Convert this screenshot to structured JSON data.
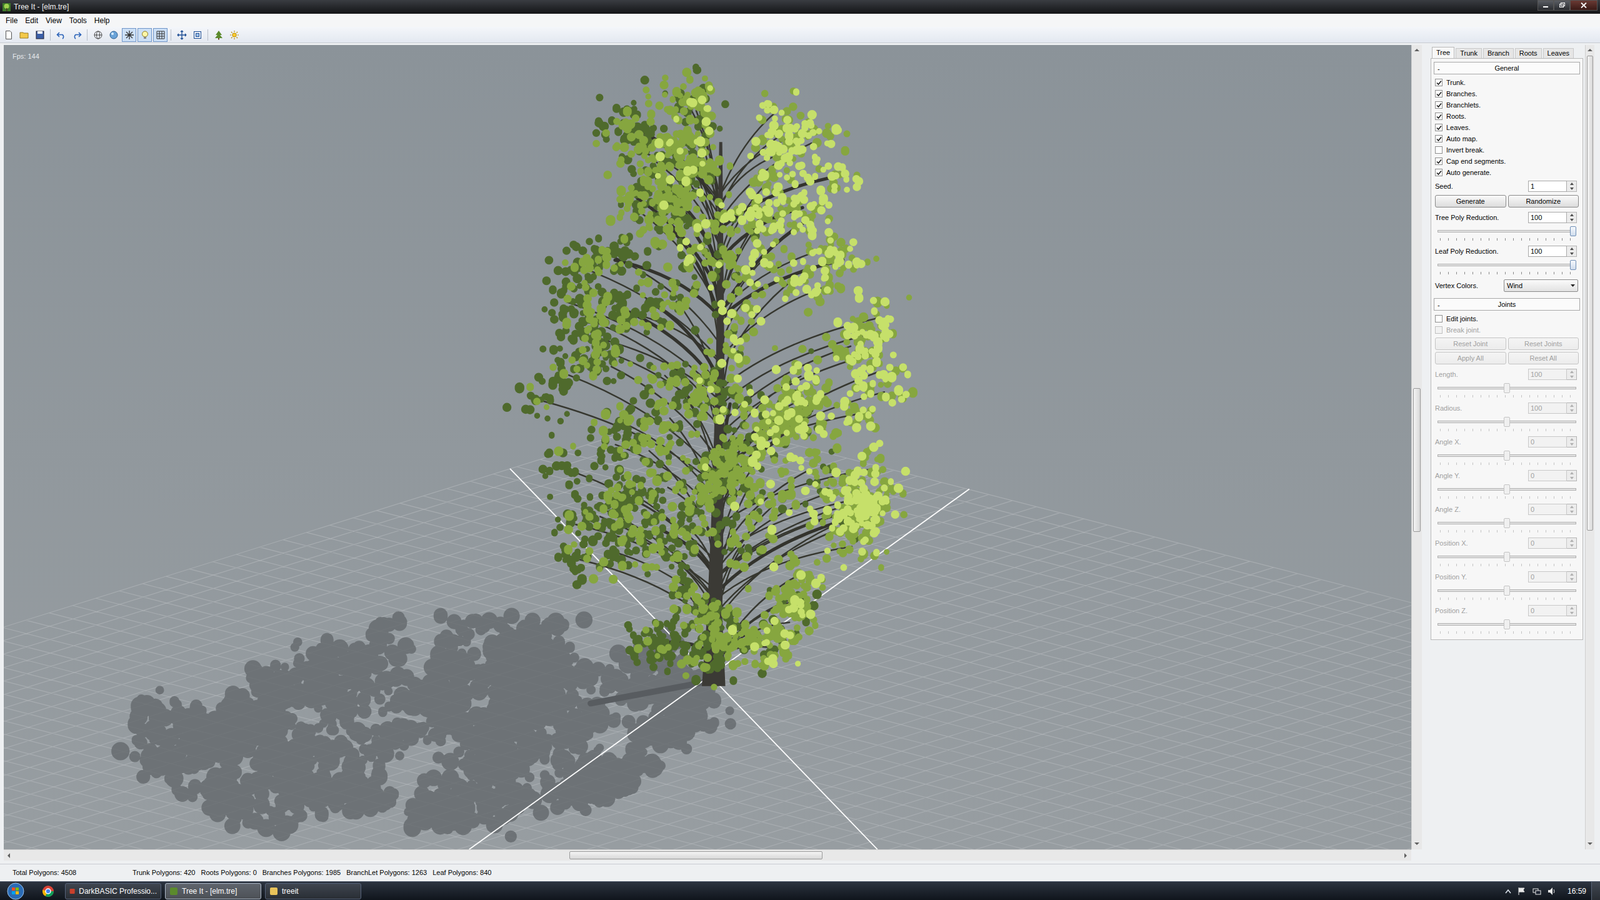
{
  "window": {
    "title": "Tree It - [elm.tre]"
  },
  "menu": [
    "File",
    "Edit",
    "View",
    "Tools",
    "Help"
  ],
  "toolbar": [
    [
      {
        "selected": false
      },
      {
        "selected": false
      },
      {
        "selected": false
      }
    ],
    [
      {
        "selected": false
      },
      {
        "selected": false
      }
    ],
    [
      {
        "selected": false
      },
      {
        "selected": false
      },
      {
        "selected": true
      },
      {
        "selected": true
      },
      {
        "selected": true
      }
    ],
    [
      {
        "selected": false
      },
      {
        "selected": false
      }
    ],
    [
      {
        "selected": false
      },
      {
        "selected": false
      }
    ]
  ],
  "viewport": {
    "fps": "Fps: 144"
  },
  "scrollbars": {
    "horizontal": {
      "level": 0.49
    },
    "vertical": {
      "level": 0.52
    },
    "panel": {
      "level": 0
    }
  },
  "panel": {
    "tabs": [
      {
        "label": "Tree",
        "selected": true
      },
      {
        "label": "Trunk",
        "selected": false
      },
      {
        "label": "Branch",
        "selected": false
      },
      {
        "label": "Roots",
        "selected": false
      },
      {
        "label": "Leaves",
        "selected": false
      }
    ],
    "sections": [
      {
        "title": "General",
        "toggle": "-",
        "expanded": true,
        "rows": [
          {
            "kind": "checkbox",
            "label": "Trunk.",
            "checked": true,
            "disabled": false
          },
          {
            "kind": "checkbox",
            "label": "Branches.",
            "checked": true,
            "disabled": false
          },
          {
            "kind": "checkbox",
            "label": "Branchlets.",
            "checked": true,
            "disabled": false
          },
          {
            "kind": "checkbox",
            "label": "Roots.",
            "checked": true,
            "disabled": false
          },
          {
            "kind": "checkbox",
            "label": "Leaves.",
            "checked": true,
            "disabled": false
          },
          {
            "kind": "checkbox",
            "label": "Auto map.",
            "checked": true,
            "disabled": false
          },
          {
            "kind": "checkbox",
            "label": "Invert break.",
            "checked": false,
            "disabled": false
          },
          {
            "kind": "checkbox",
            "label": "Cap end segments.",
            "checked": true,
            "disabled": false
          },
          {
            "kind": "checkbox",
            "label": "Auto generate.",
            "checked": true,
            "disabled": false
          },
          {
            "kind": "spinner",
            "label": "Seed.",
            "value": "1",
            "disabled": false
          },
          {
            "kind": "buttons",
            "buttons": [
              {
                "label": "Generate",
                "disabled": false
              },
              {
                "label": "Randomize",
                "disabled": false
              }
            ]
          },
          {
            "kind": "slider",
            "label": "Tree Poly Reduction.",
            "value": "100",
            "level": 1,
            "disabled": false
          },
          {
            "kind": "slider",
            "label": "Leaf Poly Reduction.",
            "value": "100",
            "level": 1,
            "disabled": false
          },
          {
            "kind": "dropdown",
            "label": "Vertex Colors.",
            "value": "Wind",
            "disabled": false
          }
        ]
      },
      {
        "title": "Joints",
        "toggle": "-",
        "expanded": true,
        "rows": [
          {
            "kind": "checkbox",
            "label": "Edit joints.",
            "checked": false,
            "disabled": false
          },
          {
            "kind": "checkbox",
            "label": "Break joint.",
            "checked": false,
            "disabled": true
          },
          {
            "kind": "buttons",
            "buttons": [
              {
                "label": "Reset Joint",
                "disabled": true
              },
              {
                "label": "Reset Joints",
                "disabled": true
              }
            ]
          },
          {
            "kind": "buttons",
            "buttons": [
              {
                "label": "Apply All",
                "disabled": true
              },
              {
                "label": "Reset All",
                "disabled": true
              }
            ]
          },
          {
            "kind": "slider",
            "label": "Length.",
            "value": "100",
            "level": 0.5,
            "disabled": true
          },
          {
            "kind": "slider",
            "label": "Radious.",
            "value": "100",
            "level": 0.5,
            "disabled": true
          },
          {
            "kind": "slider",
            "label": "Angle X.",
            "value": "0",
            "level": 0.5,
            "disabled": true
          },
          {
            "kind": "slider",
            "label": "Angle Y.",
            "value": "0",
            "level": 0.5,
            "disabled": true
          },
          {
            "kind": "slider",
            "label": "Angle Z.",
            "value": "0",
            "level": 0.5,
            "disabled": true
          },
          {
            "kind": "slider",
            "label": "Position X.",
            "value": "0",
            "level": 0.5,
            "disabled": true
          },
          {
            "kind": "slider",
            "label": "Position Y.",
            "value": "0",
            "level": 0.5,
            "disabled": true
          },
          {
            "kind": "slider",
            "label": "Position Z.",
            "value": "0",
            "level": 0.5,
            "disabled": true
          }
        ]
      }
    ]
  },
  "status_bar": {
    "total": "Total Polygons: 4508",
    "details": [
      "Trunk Polygons: 420",
      "Roots Polygons: 0",
      "Branches Polygons: 1985",
      "BranchLet Polygons: 1263",
      "Leaf Polygons: 840"
    ]
  },
  "taskbar": {
    "items": [
      {
        "label": "DarkBASIC Professio...",
        "selected": false
      },
      {
        "label": "Tree It - [elm.tre]",
        "selected": true
      },
      {
        "label": "treeit",
        "selected": false
      }
    ],
    "clock": "16:59"
  }
}
